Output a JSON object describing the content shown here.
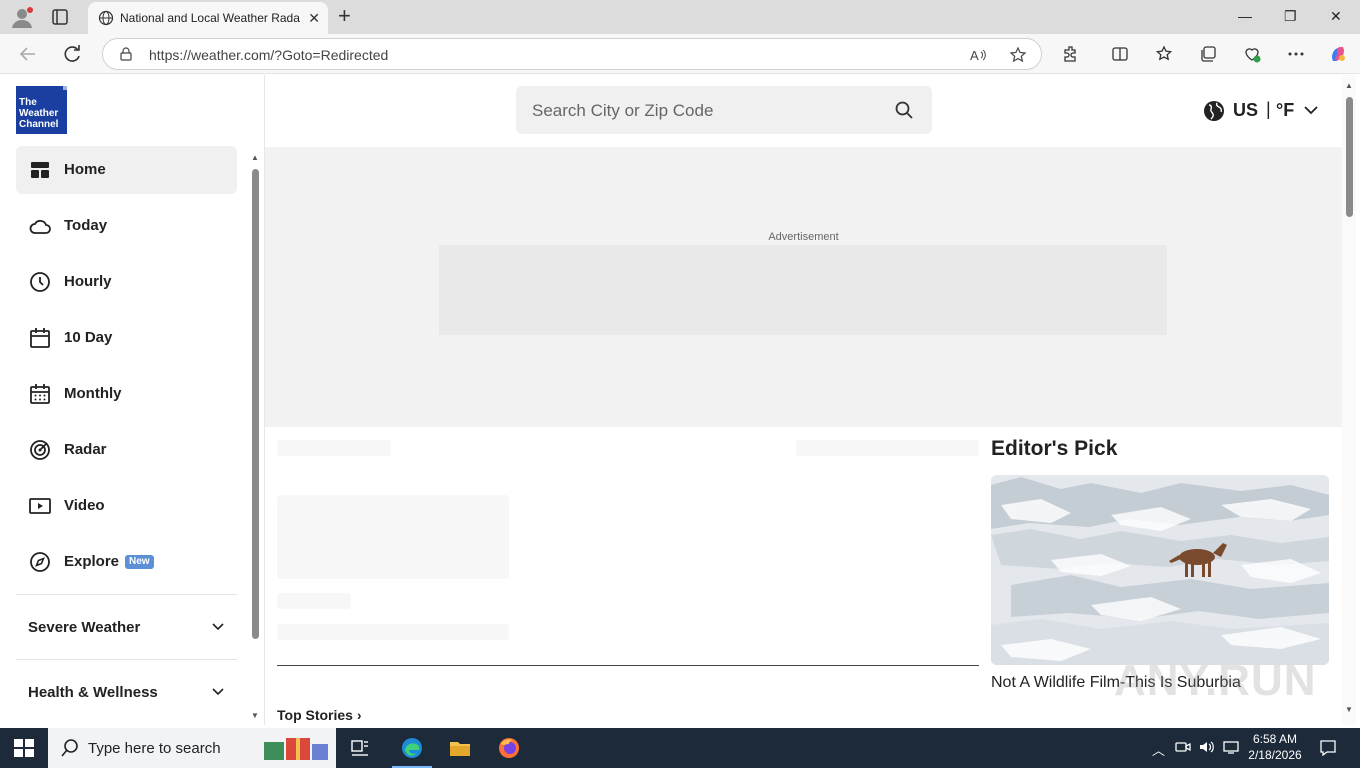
{
  "browser": {
    "tab_title": "National and Local Weather Radar, Daily Forecast",
    "url": "https://weather.com/?Goto=Redirected",
    "window_controls": {
      "minimize": "—",
      "restore": "❐",
      "close": "✕"
    },
    "new_tab": "+",
    "tab_close": "✕"
  },
  "sidebar": {
    "logo_text": "The Weather Channel",
    "logo_line1": "The",
    "logo_line2": "Weather",
    "logo_line3": "Channel",
    "items": [
      {
        "label": "Home",
        "icon": "home-grid-icon",
        "active": true
      },
      {
        "label": "Today",
        "icon": "cloud-icon"
      },
      {
        "label": "Hourly",
        "icon": "clock-icon"
      },
      {
        "label": "10 Day",
        "icon": "calendar-icon"
      },
      {
        "label": "Monthly",
        "icon": "calendar-grid-icon"
      },
      {
        "label": "Radar",
        "icon": "radar-icon"
      },
      {
        "label": "Video",
        "icon": "video-icon"
      },
      {
        "label": "Explore",
        "icon": "compass-icon",
        "badge": "New"
      }
    ],
    "sections": [
      {
        "label": "Severe Weather"
      },
      {
        "label": "Health & Wellness"
      }
    ]
  },
  "header": {
    "search_placeholder": "Search City or Zip Code",
    "country": "US",
    "separator": "|",
    "unit": "°F"
  },
  "ad": {
    "label": "Advertisement"
  },
  "content": {
    "editors_pick_title": "Editor's Pick",
    "editors_pick_caption": "Not A Wildlife Film-This Is Suburbia",
    "top_stories": "Top Stories ›"
  },
  "watermark": "ANY.RUN",
  "taskbar": {
    "search_placeholder": "Type here to search",
    "time": "6:58 AM",
    "date": "2/18/2026"
  },
  "colors": {
    "brand_blue": "#1b3fa1",
    "badge_blue": "#5b8fd6",
    "taskbar": "#1c2a3a"
  }
}
